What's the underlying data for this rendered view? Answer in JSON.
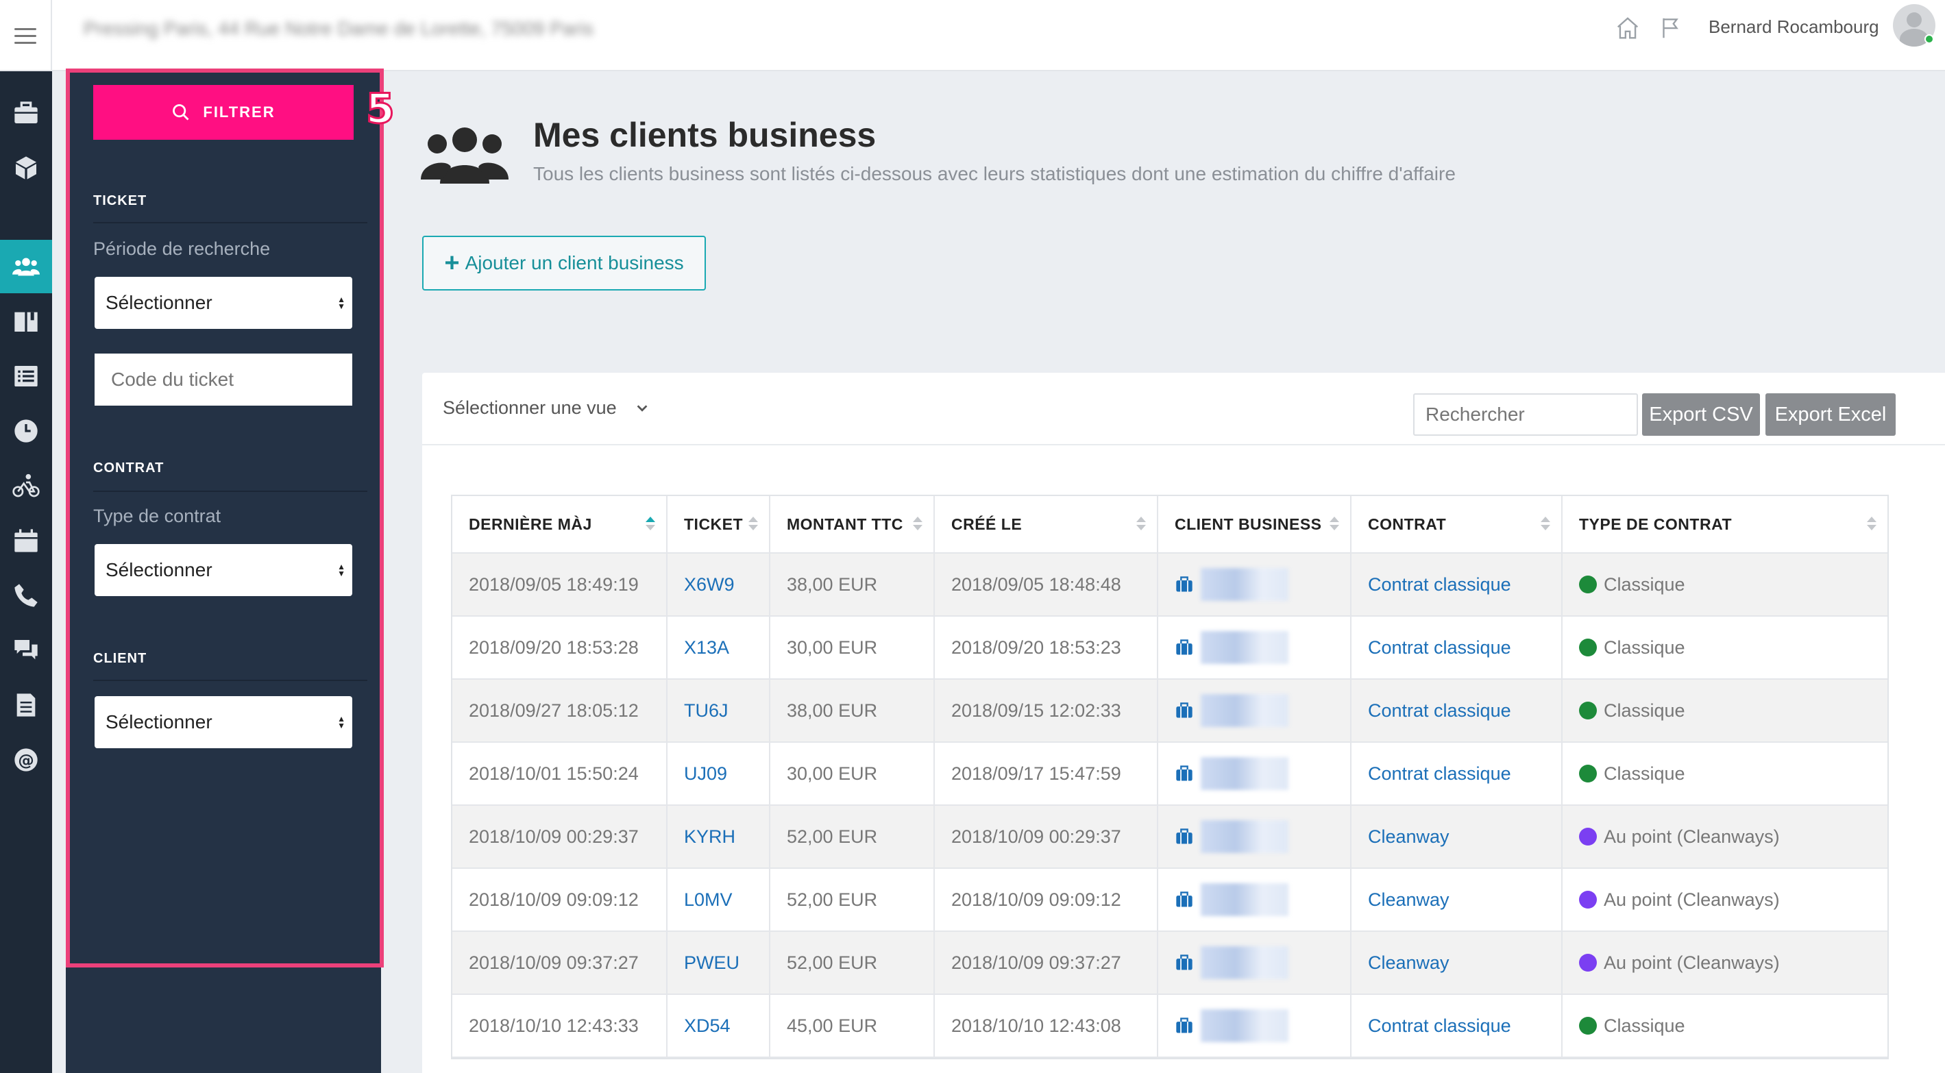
{
  "topbar": {
    "address": "Pressing Paris, 44 Rue Notre Dame de Lorette, 75009 Paris",
    "user_name": "Bernard Rocambourg",
    "icons": [
      "home-icon",
      "flag-icon"
    ]
  },
  "rail": {
    "items": [
      "briefcase-icon",
      "box-icon",
      "users-icon",
      "book-icon",
      "list-icon",
      "clock-icon",
      "bike-icon",
      "calendar-icon",
      "phone-icon",
      "chat-icon",
      "document-icon",
      "at-icon"
    ],
    "active": "users-icon"
  },
  "filters": {
    "button_label": "FILTRER",
    "step_number": "5",
    "ticket_section": "TICKET",
    "period_label": "Période de recherche",
    "period_value": "Sélectionner",
    "ticket_code_placeholder": "Code du ticket",
    "contract_section": "CONTRAT",
    "contract_type_label": "Type de contrat",
    "contract_type_value": "Sélectionner",
    "client_section": "CLIENT",
    "client_value": "Sélectionner"
  },
  "page": {
    "title": "Mes clients business",
    "subtitle": "Tous les clients business sont listés ci-dessous avec leurs statistiques dont une estimation du chiffre d'affaire",
    "add_button": "Ajouter un client business"
  },
  "table_controls": {
    "view_select": "Sélectionner une vue",
    "search_placeholder": "Rechercher",
    "export_csv": "Export CSV",
    "export_excel": "Export Excel"
  },
  "table": {
    "columns": [
      "DERNIÈRE MÀJ",
      "TICKET",
      "MONTANT TTC",
      "CRÉÉ LE",
      "CLIENT BUSINESS",
      "CONTRAT",
      "TYPE DE CONTRAT"
    ],
    "rows": [
      {
        "updated": "2018/09/05 18:49:19",
        "ticket": "X6W9",
        "amount": "38,00 EUR",
        "created": "2018/09/05 18:48:48",
        "contract": "Contrat classique",
        "type": "Classique",
        "type_color": "#1d8a3a"
      },
      {
        "updated": "2018/09/20 18:53:28",
        "ticket": "X13A",
        "amount": "30,00 EUR",
        "created": "2018/09/20 18:53:23",
        "contract": "Contrat classique",
        "type": "Classique",
        "type_color": "#1d8a3a"
      },
      {
        "updated": "2018/09/27 18:05:12",
        "ticket": "TU6J",
        "amount": "38,00 EUR",
        "created": "2018/09/15 12:02:33",
        "contract": "Contrat classique",
        "type": "Classique",
        "type_color": "#1d8a3a"
      },
      {
        "updated": "2018/10/01 15:50:24",
        "ticket": "UJ09",
        "amount": "30,00 EUR",
        "created": "2018/09/17 15:47:59",
        "contract": "Contrat classique",
        "type": "Classique",
        "type_color": "#1d8a3a"
      },
      {
        "updated": "2018/10/09 00:29:37",
        "ticket": "KYRH",
        "amount": "52,00 EUR",
        "created": "2018/10/09 00:29:37",
        "contract": "Cleanway",
        "type": "Au point (Cleanways)",
        "type_color": "#7b3ff2"
      },
      {
        "updated": "2018/10/09 09:09:12",
        "ticket": "L0MV",
        "amount": "52,00 EUR",
        "created": "2018/10/09 09:09:12",
        "contract": "Cleanway",
        "type": "Au point (Cleanways)",
        "type_color": "#7b3ff2"
      },
      {
        "updated": "2018/10/09 09:37:27",
        "ticket": "PWEU",
        "amount": "52,00 EUR",
        "created": "2018/10/09 09:37:27",
        "contract": "Cleanway",
        "type": "Au point (Cleanways)",
        "type_color": "#7b3ff2"
      },
      {
        "updated": "2018/10/10 12:43:33",
        "ticket": "XD54",
        "amount": "45,00 EUR",
        "created": "2018/10/10 12:43:08",
        "contract": "Contrat classique",
        "type": "Classique",
        "type_color": "#1d8a3a"
      }
    ]
  },
  "colors": {
    "accent_pink": "#ff0f82",
    "accent_teal": "#1aa9b2",
    "sidebar_dark": "#1e2937",
    "panel_dark": "#243245",
    "link_blue": "#1b6fb8"
  }
}
